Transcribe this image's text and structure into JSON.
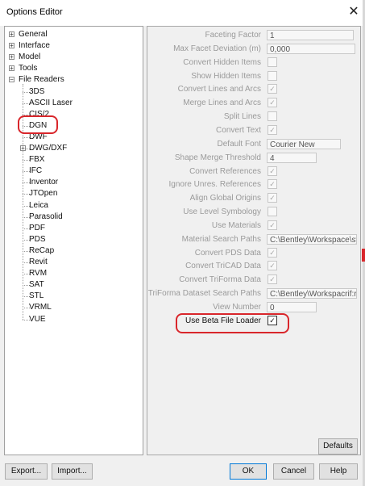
{
  "window": {
    "title": "Options Editor",
    "close_glyph": "✕"
  },
  "tree": {
    "top_level": [
      {
        "label": "General",
        "expander": "+"
      },
      {
        "label": "Interface",
        "expander": "+"
      },
      {
        "label": "Model",
        "expander": "+"
      },
      {
        "label": "Tools",
        "expander": "+"
      },
      {
        "label": "File Readers",
        "expander": "−"
      }
    ],
    "file_readers": [
      {
        "label": "3DS"
      },
      {
        "label": "ASCII Laser"
      },
      {
        "label": "CIS/2"
      },
      {
        "label": "DGN"
      },
      {
        "label": "DWF"
      },
      {
        "label": "DWG/DXF",
        "expander": "+"
      },
      {
        "label": "FBX"
      },
      {
        "label": "IFC"
      },
      {
        "label": "Inventor"
      },
      {
        "label": "JTOpen"
      },
      {
        "label": "Leica"
      },
      {
        "label": "Parasolid"
      },
      {
        "label": "PDF"
      },
      {
        "label": "PDS"
      },
      {
        "label": "ReCap"
      },
      {
        "label": "Revit"
      },
      {
        "label": "RVM"
      },
      {
        "label": "SAT"
      },
      {
        "label": "STL"
      },
      {
        "label": "VRML"
      },
      {
        "label": "VUE"
      }
    ]
  },
  "settings": [
    {
      "label": "Faceting Factor",
      "type": "text",
      "value": "1"
    },
    {
      "label": "Max Facet Deviation (m)",
      "type": "text",
      "value": "0,000"
    },
    {
      "label": "Convert Hidden Items",
      "type": "check",
      "checked": false
    },
    {
      "label": "Show Hidden Items",
      "type": "check",
      "checked": false
    },
    {
      "label": "Convert Lines and Arcs",
      "type": "check",
      "checked": true
    },
    {
      "label": "Merge Lines and Arcs",
      "type": "check",
      "checked": true
    },
    {
      "label": "Split Lines",
      "type": "check",
      "checked": false
    },
    {
      "label": "Convert Text",
      "type": "check",
      "checked": true
    },
    {
      "label": "Default Font",
      "type": "text",
      "value": "Courier New"
    },
    {
      "label": "Shape Merge Threshold",
      "type": "text",
      "value": "4"
    },
    {
      "label": "Convert References",
      "type": "check",
      "checked": true
    },
    {
      "label": "Ignore Unres. References",
      "type": "check",
      "checked": true
    },
    {
      "label": "Align Global Origins",
      "type": "check",
      "checked": true
    },
    {
      "label": "Use Level Symbology",
      "type": "check",
      "checked": false
    },
    {
      "label": "Use Materials",
      "type": "check",
      "checked": true
    },
    {
      "label": "Material Search Paths",
      "type": "text",
      "value": "C:\\Bentley\\Workspace\\sy:"
    },
    {
      "label": "Convert PDS Data",
      "type": "check",
      "checked": true
    },
    {
      "label": "Convert TriCAD Data",
      "type": "check",
      "checked": true
    },
    {
      "label": "Convert TriForma Data",
      "type": "check",
      "checked": true
    },
    {
      "label": "TriForma Dataset Search Paths",
      "type": "text",
      "value": "C:\\Bentley\\Workspacrif:rif"
    },
    {
      "label": "View Number",
      "type": "text",
      "value": "0"
    },
    {
      "label": "Use Beta File Loader",
      "type": "check",
      "checked": true,
      "enabled": true
    }
  ],
  "check_glyph": "✓",
  "buttons": {
    "defaults": "Defaults",
    "export": "Export...",
    "import": "Import...",
    "ok": "OK",
    "cancel": "Cancel",
    "help": "Help"
  },
  "colors": {
    "annotation": "#d9262b",
    "default_button_border": "#0078d7"
  }
}
